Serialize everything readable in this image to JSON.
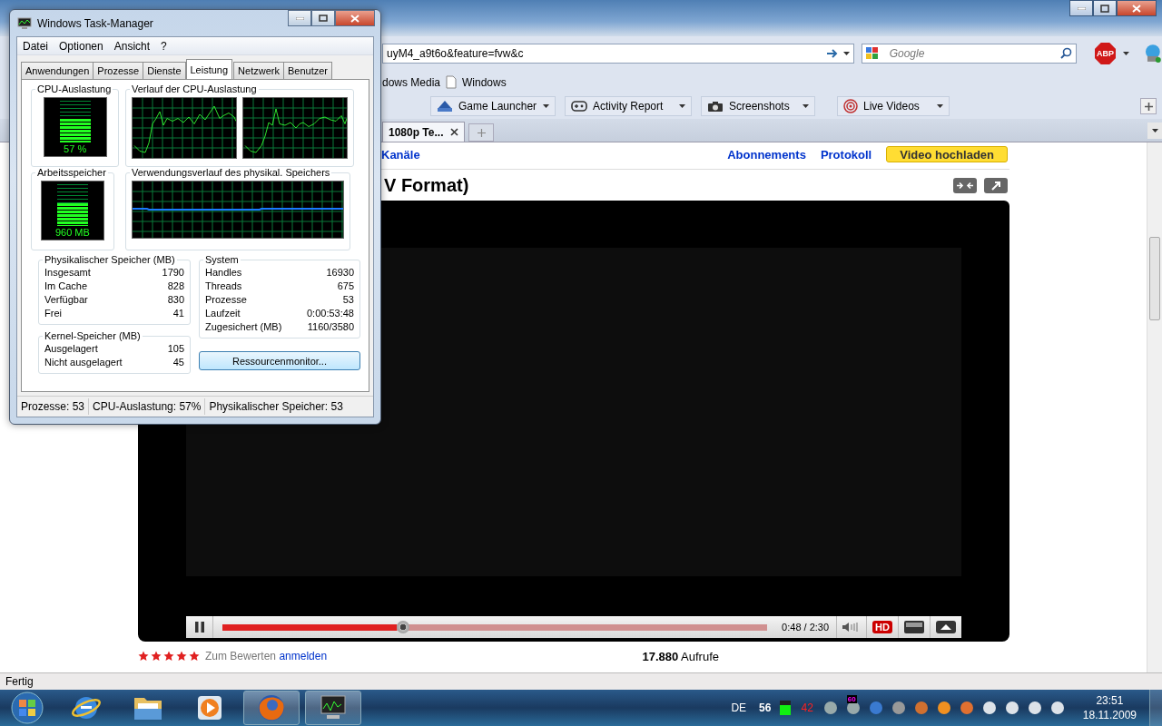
{
  "browser": {
    "address_value": "uyM4_a9t6o&feature=fvw&c",
    "search": {
      "placeholder": "Google"
    },
    "adblock_label": "ABP",
    "bookmarks": [
      "dows Media",
      "Windows"
    ],
    "toolbar_buttons": [
      "Game Launcher",
      "Activity Report",
      "Screenshots",
      "Live Videos"
    ],
    "tabs": [
      {
        "label": "1080p Te...",
        "selected": true
      }
    ],
    "page": {
      "nav_links": [
        "Kanäle",
        "Abonnements",
        "Protokoll"
      ],
      "upload_button": "Video hochladen",
      "video_title": "V Format)",
      "player": {
        "playing": true,
        "level": 0.32,
        "time": "0:48 / 2:30",
        "hd_label": "HD",
        "hd_on": true
      },
      "rating": {
        "stars": 5,
        "prompt": "Zum Bewerten",
        "login_link": "anmelden"
      },
      "views": {
        "count": "17.880",
        "label": "Aufrufe"
      }
    },
    "status": "Fertig"
  },
  "task_manager": {
    "title": "Windows Task-Manager",
    "menu": [
      "Datei",
      "Optionen",
      "Ansicht",
      "?"
    ],
    "tabs": [
      {
        "label": "Anwendungen",
        "selected": false
      },
      {
        "label": "Prozesse",
        "selected": false
      },
      {
        "label": "Dienste",
        "selected": false
      },
      {
        "label": "Leistung",
        "selected": true
      },
      {
        "label": "Netzwerk",
        "selected": false
      },
      {
        "label": "Benutzer",
        "selected": false
      }
    ],
    "cpu": {
      "heading": "CPU-Auslastung",
      "level": 0.57,
      "reading": "57 %"
    },
    "cpu_history": {
      "heading": "Verlauf der CPU-Auslastung"
    },
    "memory": {
      "heading": "Arbeitsspeicher",
      "level": 0.54,
      "reading": "960 MB"
    },
    "memory_history": {
      "heading": "Verwendungsverlauf des physikal. Speichers"
    },
    "physical_memory": {
      "heading": "Physikalischer Speicher (MB)",
      "rows": [
        {
          "label": "Insgesamt",
          "value": "1790"
        },
        {
          "label": "Im Cache",
          "value": "828"
        },
        {
          "label": "Verfügbar",
          "value": "830"
        },
        {
          "label": "Frei",
          "value": "41"
        }
      ]
    },
    "system": {
      "heading": "System",
      "rows": [
        {
          "label": "Handles",
          "value": "16930"
        },
        {
          "label": "Threads",
          "value": "675"
        },
        {
          "label": "Prozesse",
          "value": "53"
        },
        {
          "label": "Laufzeit",
          "value": "0:00:53:48"
        },
        {
          "label": "Zugesichert (MB)",
          "value": "1160/3580"
        }
      ]
    },
    "kernel_memory": {
      "heading": "Kernel-Speicher (MB)",
      "rows": [
        {
          "label": "Ausgelagert",
          "value": "105"
        },
        {
          "label": "Nicht ausgelagert",
          "value": "45"
        }
      ]
    },
    "resource_button": "Ressourcenmonitor...",
    "status": [
      "Prozesse: 53",
      "CPU-Auslastung: 57%",
      "Physikalischer Speicher: 53"
    ]
  },
  "taskbar": {
    "apps": [
      {
        "kind": "ie",
        "selected": false
      },
      {
        "kind": "explorer",
        "selected": false
      },
      {
        "kind": "media",
        "selected": false
      },
      {
        "kind": "firefox",
        "selected": true
      },
      {
        "kind": "taskmgr",
        "selected": true
      }
    ],
    "language": "DE",
    "tray_counters": [
      {
        "text": "56",
        "color": "#ffffff"
      },
      {
        "text": "42",
        "color": "#ff2020"
      }
    ],
    "tray_badge": "60",
    "time": "23:51",
    "date": "18.11.2009"
  }
}
